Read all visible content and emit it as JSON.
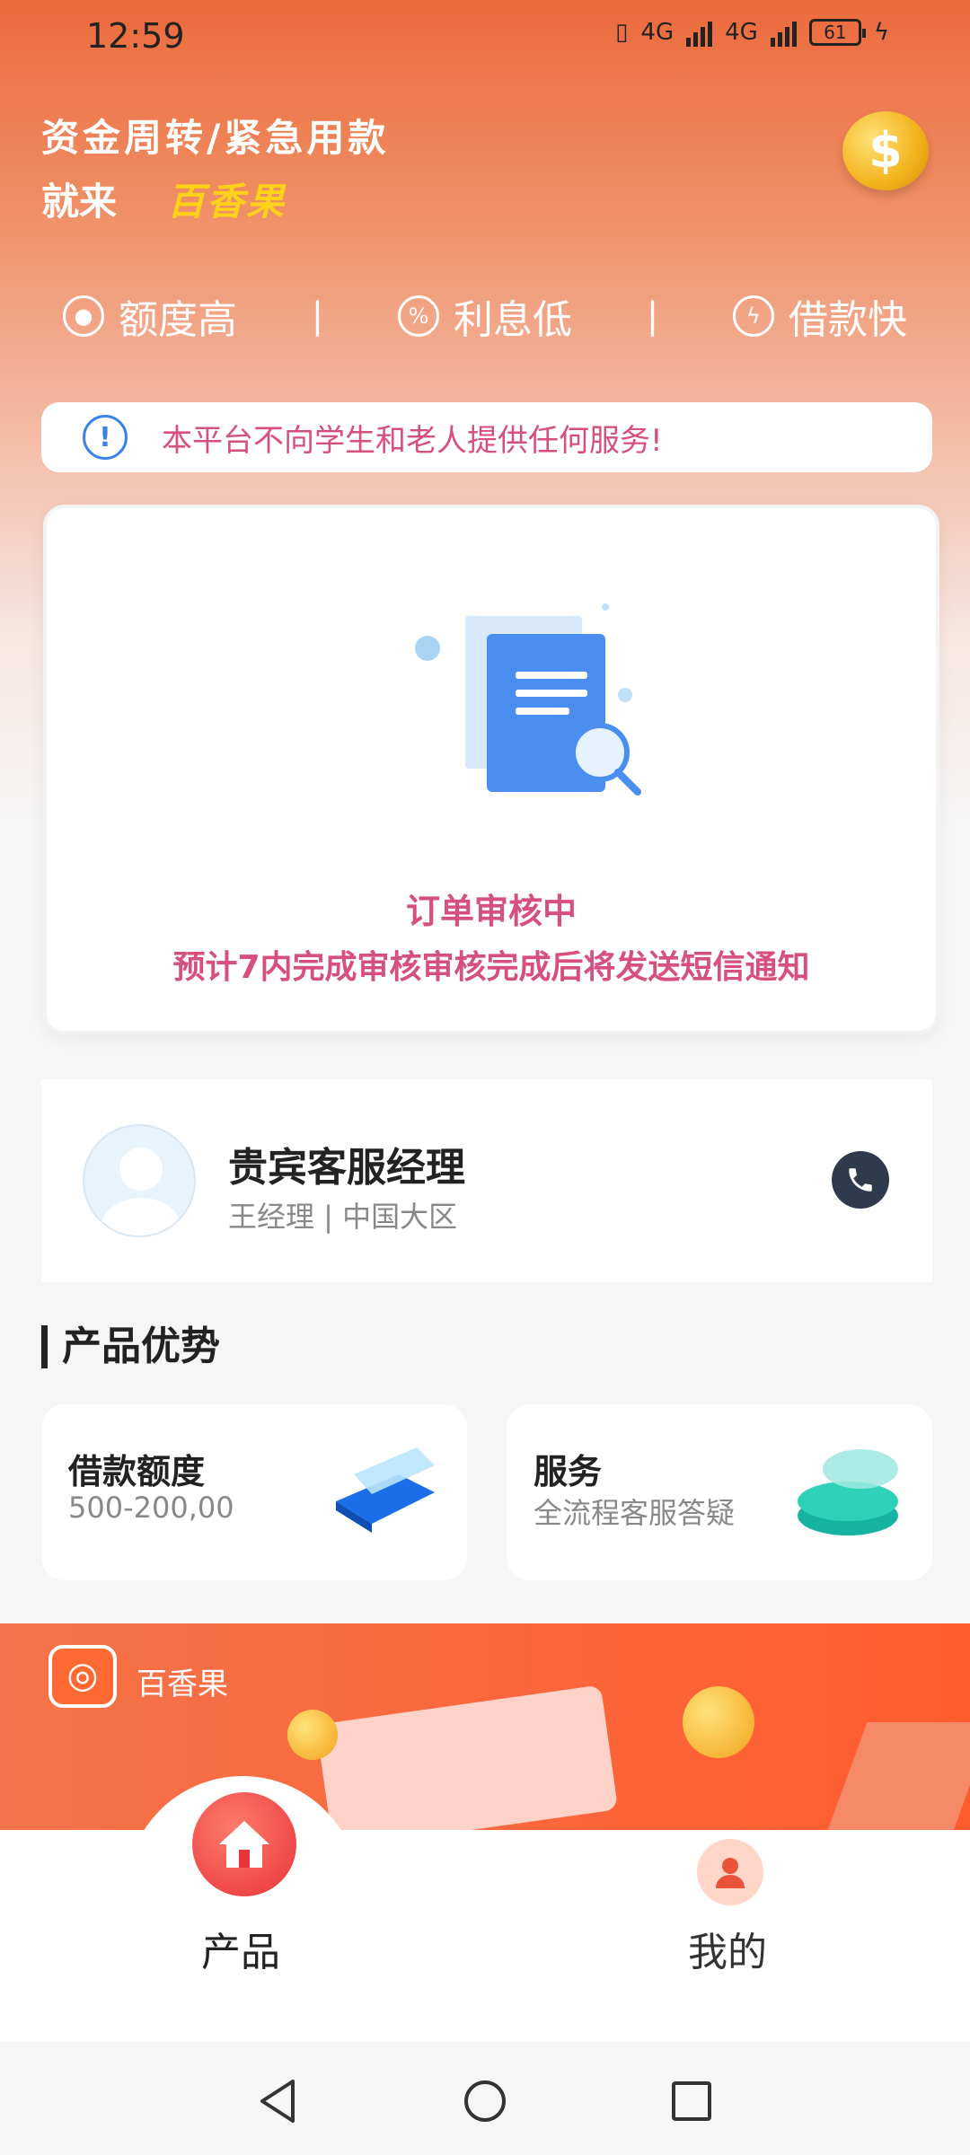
{
  "status_bar": {
    "time": "12:59",
    "network_1": "4G",
    "network_2": "4G",
    "battery": "61"
  },
  "header": {
    "headline_line1": "资金周转/紧急用款",
    "headline_prefix": "就来",
    "brand": "百香果",
    "coin_symbol": "$"
  },
  "features": [
    {
      "label": "额度高",
      "icon": "coin-bag-icon"
    },
    {
      "label": "利息低",
      "icon": "discount-icon"
    },
    {
      "label": "借款快",
      "icon": "lightning-icon"
    }
  ],
  "separator": "|",
  "notice": {
    "icon": "!",
    "text": "本平台不向学生和老人提供任何服务!"
  },
  "review": {
    "title": "订单审核中",
    "subtitle": "预计7内完成审核审核完成后将发送短信通知"
  },
  "manager": {
    "title": "贵宾客服经理",
    "subtitle": "王经理 | 中国大区"
  },
  "section": {
    "title": "产品优势"
  },
  "advantages": [
    {
      "title": "借款额度",
      "subtitle": "500-200,00"
    },
    {
      "title": "服务",
      "subtitle": "全流程客服答疑"
    }
  ],
  "banner": {
    "app_name": "百香果"
  },
  "bottom_nav": {
    "products_label": "产品",
    "mine_label": "我的"
  },
  "colors": {
    "primary": "#ec6a3c",
    "accent_pink": "#d64f80",
    "brand_yellow": "#ffd21a",
    "info_blue": "#3b82e8"
  }
}
